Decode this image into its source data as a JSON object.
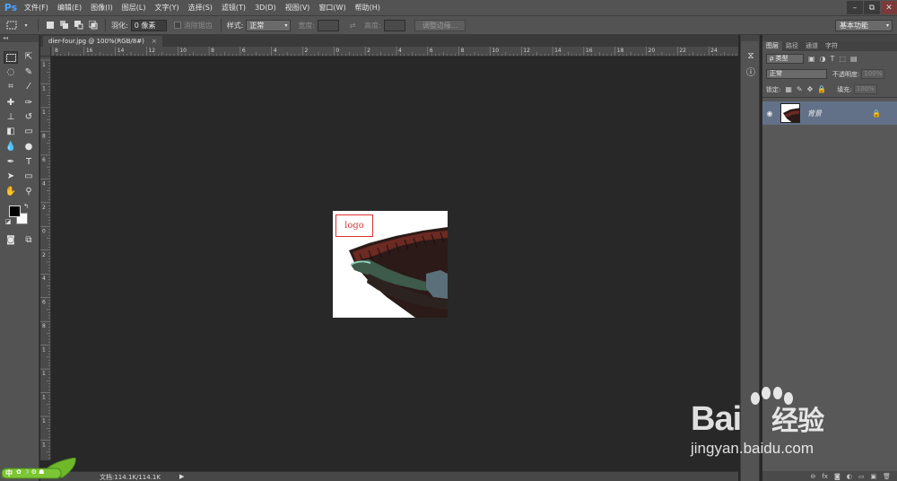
{
  "app": {
    "logo": "Ps"
  },
  "menu": [
    "文件(F)",
    "编辑(E)",
    "图像(I)",
    "图层(L)",
    "文字(Y)",
    "选择(S)",
    "滤镜(T)",
    "3D(D)",
    "视图(V)",
    "窗口(W)",
    "帮助(H)"
  ],
  "window_controls": {
    "minimize": "–",
    "restore": "⧉",
    "close": "✕"
  },
  "options": {
    "feather_label": "羽化:",
    "feather_value": "0 像素",
    "antialias_label": "消除锯齿",
    "style_label": "样式:",
    "style_value": "正常",
    "width_label": "宽度:",
    "height_label": "高度:",
    "refine_edge": "调整边缘...",
    "workspace": "基本功能"
  },
  "document": {
    "tab_title": "dier-four.jpg @ 100%(RGB/8#)",
    "close": "×"
  },
  "ruler": {
    "h_labels": [
      "8",
      "16",
      "14",
      "12",
      "10",
      "8",
      "6",
      "4",
      "2",
      "0",
      "2",
      "4",
      "6",
      "8",
      "10",
      "12",
      "14",
      "16",
      "18",
      "20",
      "22",
      "24"
    ],
    "v_labels": [
      "1",
      "1",
      "1",
      "8",
      "6",
      "4",
      "2",
      "0",
      "2",
      "4",
      "6",
      "8",
      "1",
      "1",
      "1",
      "1",
      "1"
    ]
  },
  "canvas_image": {
    "logo_text": "logo"
  },
  "status": {
    "doc_info": "文档:114.1K/114.1K",
    "arrow": "▶"
  },
  "layers": {
    "tabs": [
      "图层",
      "路径",
      "通道",
      "字符"
    ],
    "filter_kind": "ρ 类型",
    "blend_mode": "正常",
    "opacity_label": "不透明度:",
    "opacity_value": "100%",
    "lock_label": "锁定:",
    "fill_label": "填充:",
    "fill_value": "100%",
    "layer_name": "背景"
  },
  "watermark": {
    "brand": "Bai",
    "brand_cn": "经验",
    "url": "jingyan.baidu.com"
  },
  "ime": {
    "label": "中"
  }
}
